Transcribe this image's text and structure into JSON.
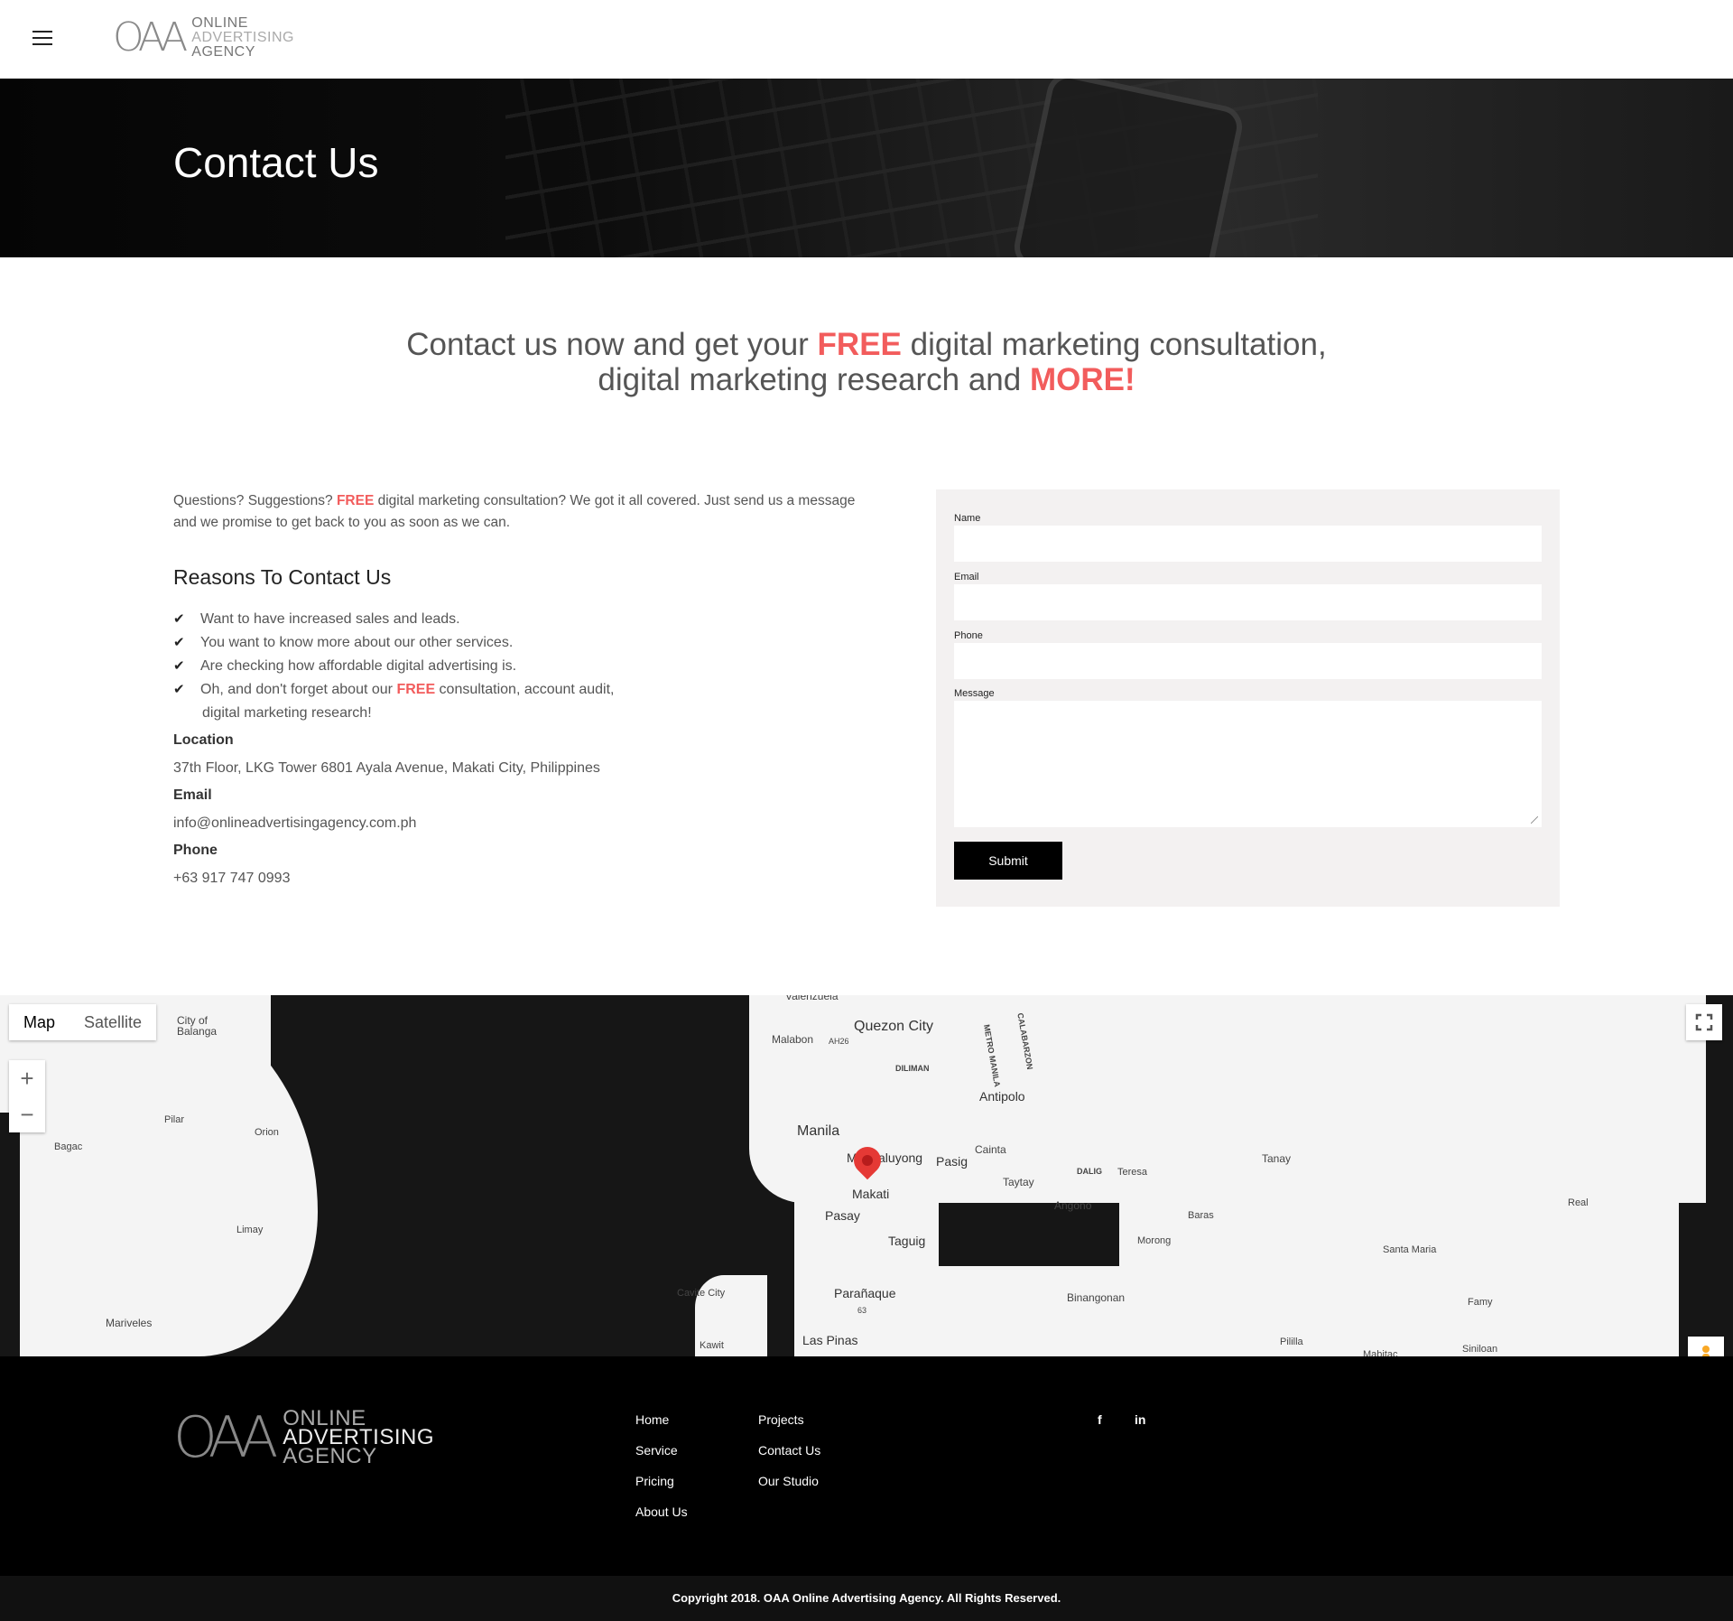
{
  "header": {
    "logo_mark": "OAA",
    "logo_line1": "ONLINE",
    "logo_line2": "ADVERTISING",
    "logo_line3": "AGENCY"
  },
  "hero": {
    "title": "Contact Us"
  },
  "headline": {
    "part1": "Contact us now and get your ",
    "free": "FREE",
    "part2": " digital marketing consultation,",
    "part3": "digital marketing research and ",
    "more": "MORE!"
  },
  "intro": {
    "part1": "Questions? Suggestions? ",
    "free": "FREE",
    "part2": " digital marketing consultation? We got it all covered. Just send us a message and we promise to get back to you as soon as we can."
  },
  "reasons": {
    "title": "Reasons To Contact Us",
    "items": [
      "Want to have increased sales and leads.",
      "You want to know more about our other services.",
      "Are checking how affordable digital advertising is."
    ],
    "last_part1": "Oh, and don't forget about our ",
    "last_free": "FREE",
    "last_part2": " consultation, account audit,",
    "last_part3": "digital marketing research!"
  },
  "info": {
    "location_label": "Location",
    "location_value": "37th Floor, LKG Tower 6801 Ayala Avenue, Makati City, Philippines",
    "email_label": "Email",
    "email_value": "info@onlineadvertisingagency.com.ph",
    "phone_label": "Phone",
    "phone_value": "+63 917 747 0993"
  },
  "form": {
    "name_label": "Name",
    "email_label": "Email",
    "phone_label": "Phone",
    "message_label": "Message",
    "submit_label": "Submit"
  },
  "map": {
    "type_map": "Map",
    "type_satellite": "Satellite",
    "zoom_in": "+",
    "zoom_out": "−",
    "labels": {
      "valenzuela": "Valenzuela",
      "quezon": "Quezon City",
      "malabon": "Malabon",
      "dilimian": "DILIMAN",
      "metro_manila": "METRO MANILA",
      "calabarzon": "CALABARZON",
      "antipolo": "Antipolo",
      "manila": "Manila",
      "mandaluyong": "Mandaluyong",
      "pasig": "Pasig",
      "cainta": "Cainta",
      "makati": "Makati",
      "taytay": "Taytay",
      "dalig": "DALIG",
      "teresa": "Teresa",
      "tanay": "Tanay",
      "angono": "Angono",
      "pasay": "Pasay",
      "baras": "Baras",
      "real": "Real",
      "taguig": "Taguig",
      "morong": "Morong",
      "santa_maria": "Santa Maria",
      "cavite": "Cavite City",
      "paranaque": "Parañaque",
      "binangonan": "Binangonan",
      "famy": "Famy",
      "kawit": "Kawit",
      "las_pinas": "Las Pinas",
      "pililla": "Pililla",
      "mabitac": "Mabitac",
      "siniloan": "Siniloan",
      "balanga": "City of Balanga",
      "pilar": "Pilar",
      "orion": "Orion",
      "bagac": "Bagac",
      "limay": "Limay",
      "mariveles": "Mariveles",
      "ah26": "AH26",
      "r63": "63"
    }
  },
  "footer": {
    "logo_mark": "OAA",
    "logo_line1": "ONLINE",
    "logo_line2": "ADVERTISING",
    "logo_line3": "AGENCY",
    "nav_col1": [
      "Home",
      "Service",
      "Pricing",
      "About Us"
    ],
    "nav_col2": [
      "Projects",
      "Contact Us",
      "Our Studio"
    ],
    "social_facebook": "f",
    "social_linkedin": "in",
    "copyright": "Copyright 2018. OAA Online Advertising Agency. All Rights Reserved."
  },
  "colors": {
    "accent": "#f25c5c",
    "footer_bg": "#000000",
    "form_bg": "#f3f1f1"
  },
  "icons": [
    "menu-icon",
    "check-icon",
    "map-pin-icon",
    "fullscreen-icon",
    "pegman-icon",
    "facebook-icon",
    "linkedin-icon"
  ]
}
